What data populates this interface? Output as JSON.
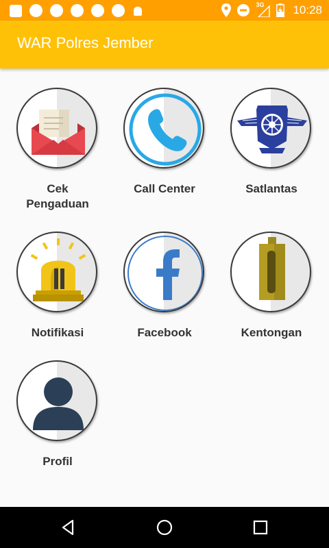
{
  "status_bar": {
    "time": "10:28",
    "network": "3G",
    "icons": [
      "notification-square",
      "notification-circle",
      "notification-circle",
      "notification-circle",
      "notification-circle",
      "notification-circle",
      "android-icon",
      "location-icon",
      "do-not-disturb-icon",
      "signal-icon",
      "battery-icon"
    ]
  },
  "app_bar": {
    "title": "WAR Polres Jember"
  },
  "menu": [
    {
      "label_line1": "Cek",
      "label_line2": "Pengaduan",
      "icon": "envelope-icon"
    },
    {
      "label_line1": "Call Center",
      "label_line2": "",
      "icon": "phone-icon"
    },
    {
      "label_line1": "Satlantas",
      "label_line2": "",
      "icon": "police-emblem-icon"
    },
    {
      "label_line1": "Notifikasi",
      "label_line2": "",
      "icon": "siren-icon"
    },
    {
      "label_line1": "Facebook",
      "label_line2": "",
      "icon": "facebook-icon"
    },
    {
      "label_line1": "Kentongan",
      "label_line2": "",
      "icon": "kentongan-icon"
    },
    {
      "label_line1": "Profil",
      "label_line2": "",
      "icon": "user-icon"
    }
  ],
  "nav_bar": {
    "buttons": [
      "back-icon",
      "home-icon",
      "recents-icon"
    ]
  },
  "colors": {
    "status_bar": "#ffa000",
    "app_bar": "#ffc107",
    "background": "#fafafa"
  }
}
